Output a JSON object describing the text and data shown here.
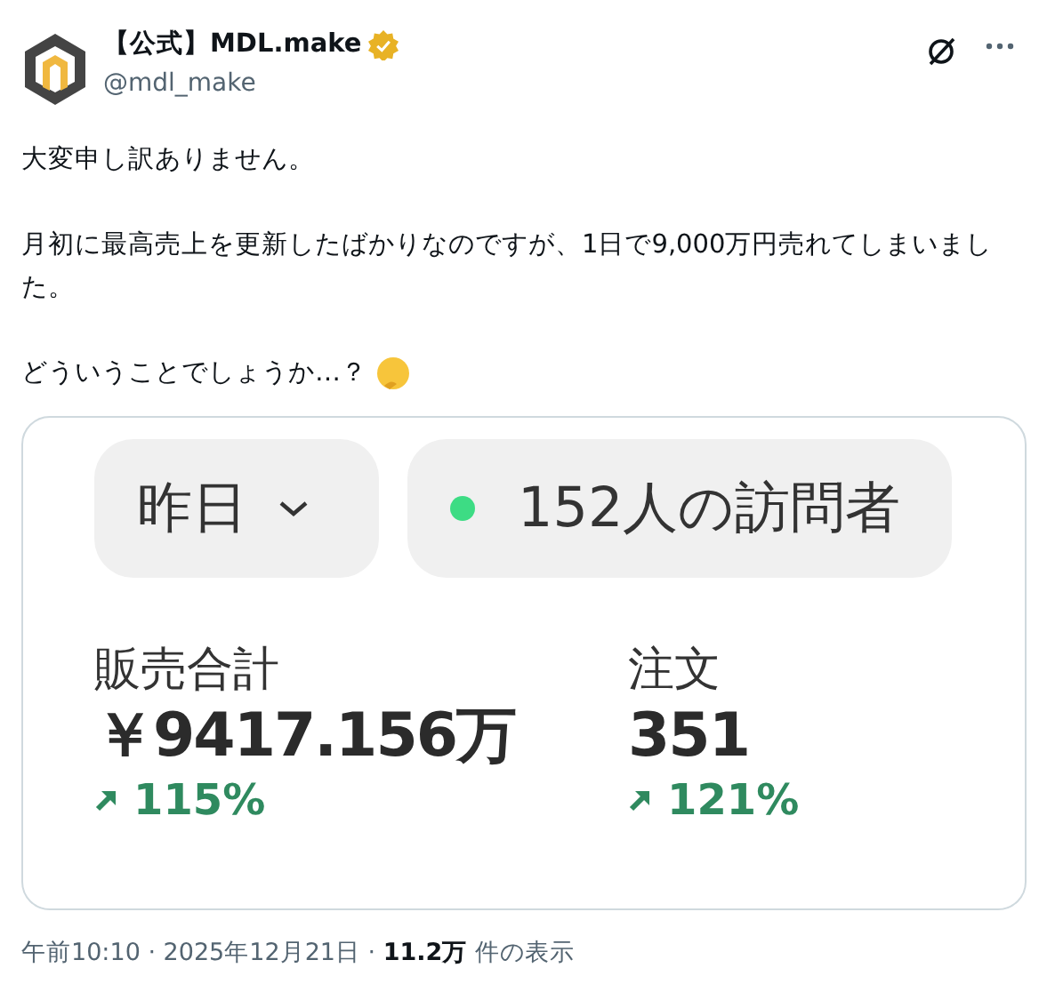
{
  "post": {
    "author": "【公式】MDL.make",
    "verified": true,
    "handle": "@mdl_make",
    "paragraphs": [
      "大変申し訳ありません。",
      "月初に最高売上を更新したばかりなのですが、1日で9,000万円売れてしまいました。",
      "どういうことでしょうか…？"
    ],
    "image": {
      "filter": "昨日",
      "visitors": "152人の訪問者",
      "metrics": [
        {
          "label": "販売合計",
          "value": "￥9417.156万",
          "change": "115%"
        },
        {
          "label": "注文",
          "value": "351",
          "change": "121%"
        }
      ]
    },
    "footer": "午前10:10 · 2025年12月21日 · **11.2万** 件の表示"
  }
}
